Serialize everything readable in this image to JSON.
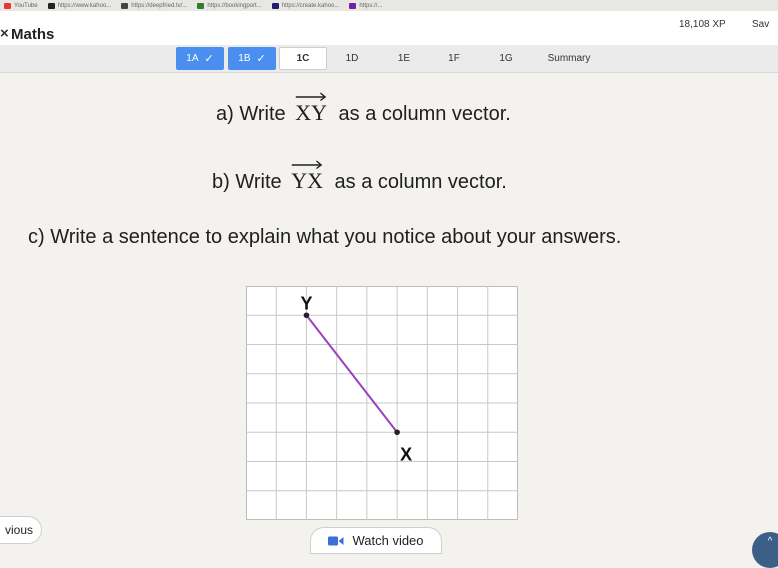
{
  "browser": {
    "bookmarks": [
      {
        "label": "YouTube",
        "color": "#e53935"
      },
      {
        "label": "https://www.kahoo...",
        "color": "#222222"
      },
      {
        "label": "https://deepfried.tv/...",
        "color": "#444444"
      },
      {
        "label": "https://bookingport...",
        "color": "#2e7d32"
      },
      {
        "label": "https://create.kahoo...",
        "color": "#1e1e6e"
      },
      {
        "label": "https://...",
        "color": "#7b1fa2"
      }
    ]
  },
  "header": {
    "title": "Maths",
    "close_icon": "×",
    "xp": "18,108 XP",
    "save_label": "Sav"
  },
  "tabs": [
    {
      "label": "1A",
      "state": "done"
    },
    {
      "label": "1B",
      "state": "done"
    },
    {
      "label": "1C",
      "state": "active"
    },
    {
      "label": "1D",
      "state": "todo"
    },
    {
      "label": "1E",
      "state": "todo"
    },
    {
      "label": "1F",
      "state": "todo"
    },
    {
      "label": "1G",
      "state": "todo"
    },
    {
      "label": "Summary",
      "state": "todo"
    }
  ],
  "question": {
    "a_prefix": "a) Write",
    "a_vector": "XY",
    "a_suffix": "as a column vector.",
    "b_prefix": "b) Write",
    "b_vector": "YX",
    "b_suffix": "as a column vector.",
    "c_text": "c) Write a sentence to explain what you notice about your answers."
  },
  "diagram": {
    "cols": 9,
    "rows": 8,
    "point_y": {
      "label": "Y",
      "col": 2,
      "row": 1
    },
    "point_x": {
      "label": "X",
      "col": 5,
      "row": 5
    },
    "line_color": "#9b3fbf"
  },
  "footer": {
    "previous_label": "vious",
    "watch_video_label": "Watch video",
    "scroll_icon": "^"
  },
  "colors": {
    "accent_blue": "#4a8ff0",
    "scroll_button": "#3b5f86"
  }
}
